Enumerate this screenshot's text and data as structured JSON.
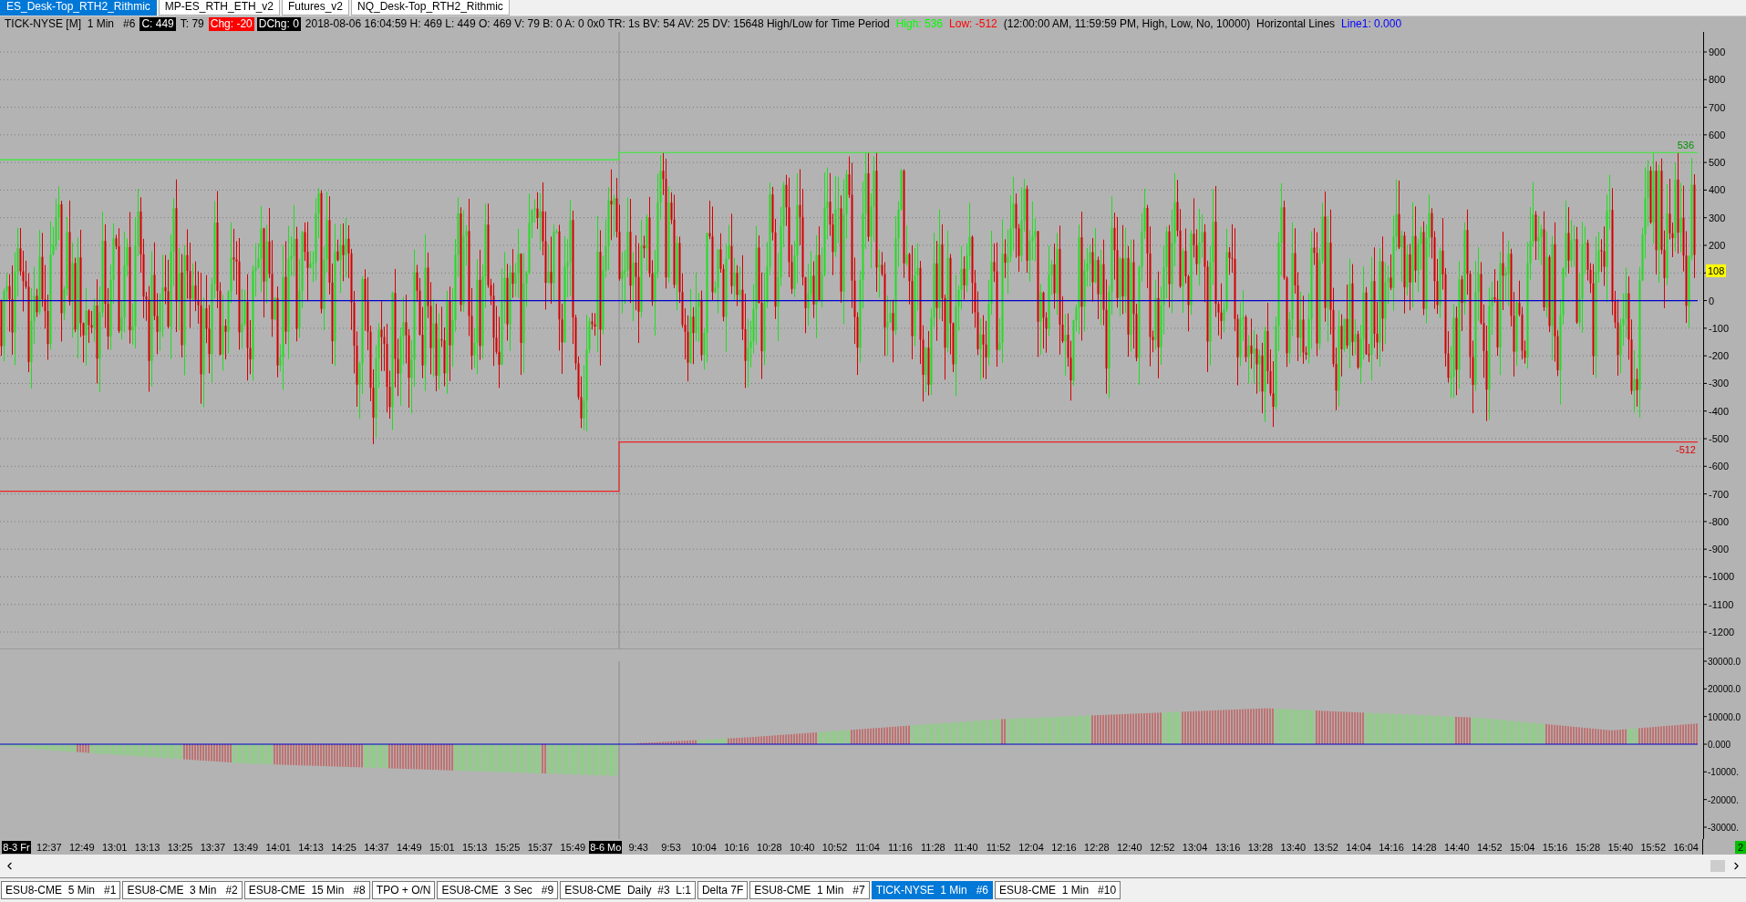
{
  "workspace_tabs": [
    {
      "label": "ES_Desk-Top_RTH2_Rithmic",
      "selected": true
    },
    {
      "label": "MP-ES_RTH_ETH_v2",
      "selected": false
    },
    {
      "label": "Futures_v2",
      "selected": false
    },
    {
      "label": "NQ_Desk-Top_RTH2_Rithmic",
      "selected": false
    }
  ],
  "info_bar": [
    {
      "kind": "plain",
      "text": "TICK-NYSE [M]  1 Min   #6"
    },
    {
      "kind": "boxed",
      "text": "C: 449",
      "color": "#000000"
    },
    {
      "kind": "plain",
      "text": "T: 79"
    },
    {
      "kind": "boxed",
      "text": "Chg: -20",
      "color": "#ff0000"
    },
    {
      "kind": "boxed",
      "text": "DChg: 0",
      "color": "#000000"
    },
    {
      "kind": "plain",
      "text": "2018-08-06 16:04:59 H: 469 L: 449 O: 469 V: 79 B: 0 A: 0 0x0 TR: 1s BV: 54 AV: 25 DV: 15648 High/Low for Time Period"
    },
    {
      "kind": "colored",
      "text": "High: 536",
      "color": "#00ff00"
    },
    {
      "kind": "colored",
      "text": "Low: -512",
      "color": "#ff0000"
    },
    {
      "kind": "plain",
      "text": "(12:00:00 AM, 11:59:59 PM, High, Low, No, 10000)  Horizontal Lines"
    },
    {
      "kind": "colored",
      "text": "Line1: 0.000",
      "color": "#0000ff"
    }
  ],
  "price_pane": {
    "ticks": [
      "900",
      "800",
      "700",
      "600",
      "500",
      "400",
      "300",
      "200",
      "0",
      "-100",
      "-200",
      "-300",
      "-400",
      "-500",
      "-600",
      "-700",
      "-800",
      "-900",
      "-1000",
      "-1100",
      "-1200"
    ],
    "high_label": "536",
    "low_label": "-512",
    "last_badge": "108"
  },
  "volume_pane": {
    "ticks": [
      "30000.0",
      "20000.0",
      "10000.0",
      "0.000",
      "-10000.",
      "-20000.",
      "-30000."
    ]
  },
  "time_axis": [
    {
      "text": "8-3 Fr",
      "boxed": true
    },
    {
      "text": "12:37",
      "boxed": false
    },
    {
      "text": "12:49",
      "boxed": false
    },
    {
      "text": "13:01",
      "boxed": false
    },
    {
      "text": "13:13",
      "boxed": false
    },
    {
      "text": "13:25",
      "boxed": false
    },
    {
      "text": "13:37",
      "boxed": false
    },
    {
      "text": "13:49",
      "boxed": false
    },
    {
      "text": "14:01",
      "boxed": false
    },
    {
      "text": "14:13",
      "boxed": false
    },
    {
      "text": "14:25",
      "boxed": false
    },
    {
      "text": "14:37",
      "boxed": false
    },
    {
      "text": "14:49",
      "boxed": false
    },
    {
      "text": "15:01",
      "boxed": false
    },
    {
      "text": "15:13",
      "boxed": false
    },
    {
      "text": "15:25",
      "boxed": false
    },
    {
      "text": "15:37",
      "boxed": false
    },
    {
      "text": "15:49",
      "boxed": false
    },
    {
      "text": "8-6 Mo",
      "boxed": true
    },
    {
      "text": "9:43",
      "boxed": false
    },
    {
      "text": "9:53",
      "boxed": false
    },
    {
      "text": "10:04",
      "boxed": false
    },
    {
      "text": "10:16",
      "boxed": false
    },
    {
      "text": "10:28",
      "boxed": false
    },
    {
      "text": "10:40",
      "boxed": false
    },
    {
      "text": "10:52",
      "boxed": false
    },
    {
      "text": "11:04",
      "boxed": false
    },
    {
      "text": "11:16",
      "boxed": false
    },
    {
      "text": "11:28",
      "boxed": false
    },
    {
      "text": "11:40",
      "boxed": false
    },
    {
      "text": "11:52",
      "boxed": false
    },
    {
      "text": "12:04",
      "boxed": false
    },
    {
      "text": "12:16",
      "boxed": false
    },
    {
      "text": "12:28",
      "boxed": false
    },
    {
      "text": "12:40",
      "boxed": false
    },
    {
      "text": "12:52",
      "boxed": false
    },
    {
      "text": "13:04",
      "boxed": false
    },
    {
      "text": "13:16",
      "boxed": false
    },
    {
      "text": "13:28",
      "boxed": false
    },
    {
      "text": "13:40",
      "boxed": false
    },
    {
      "text": "13:52",
      "boxed": false
    },
    {
      "text": "14:04",
      "boxed": false
    },
    {
      "text": "14:16",
      "boxed": false
    },
    {
      "text": "14:28",
      "boxed": false
    },
    {
      "text": "14:40",
      "boxed": false
    },
    {
      "text": "14:52",
      "boxed": false
    },
    {
      "text": "15:04",
      "boxed": false
    },
    {
      "text": "15:16",
      "boxed": false
    },
    {
      "text": "15:28",
      "boxed": false
    },
    {
      "text": "15:40",
      "boxed": false
    },
    {
      "text": "15:52",
      "boxed": false
    },
    {
      "text": "16:04",
      "boxed": false
    }
  ],
  "corner_badge": "2",
  "chart_tabs": [
    {
      "label": "ESU8-CME  5 Min   #1",
      "selected": false
    },
    {
      "label": "ESU8-CME  3 Min   #2",
      "selected": false
    },
    {
      "label": "ESU8-CME  15 Min   #8",
      "selected": false
    },
    {
      "label": "TPO + O/N",
      "selected": false
    },
    {
      "label": "ESU8-CME  3 Sec   #9",
      "selected": false
    },
    {
      "label": "ESU8-CME  Daily  #3  L:1",
      "selected": false
    },
    {
      "label": "Delta 7F",
      "selected": false
    },
    {
      "label": "ESU8-CME  1 Min   #7",
      "selected": false
    },
    {
      "label": "TICK-NYSE  1 Min   #6",
      "selected": true
    },
    {
      "label": "ESU8-CME  1 Min   #10",
      "selected": false
    }
  ]
}
